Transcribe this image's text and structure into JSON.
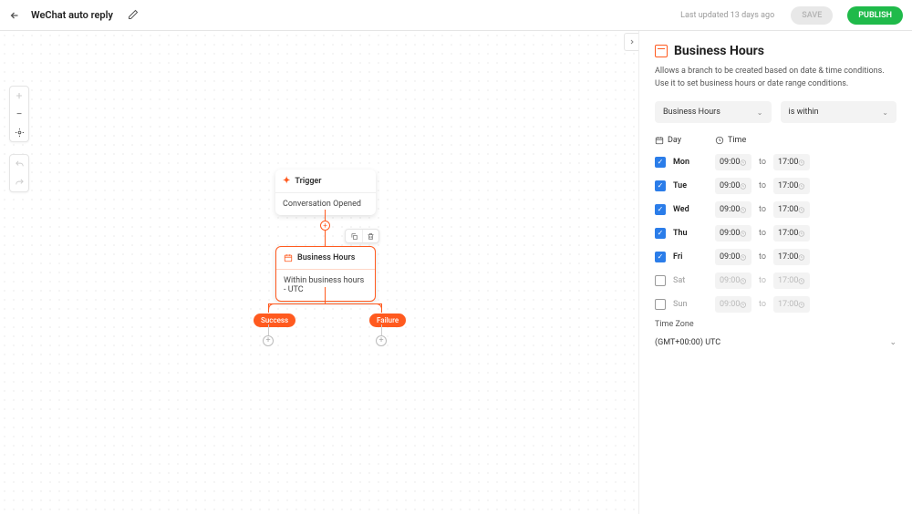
{
  "header": {
    "title": "WeChat auto reply",
    "last_updated": "Last updated 13 days ago",
    "save_label": "SAVE",
    "publish_label": "PUBLISH"
  },
  "canvas": {
    "trigger": {
      "title": "Trigger",
      "body": "Conversation Opened"
    },
    "business_hours": {
      "title": "Business Hours",
      "body": "Within business hours - UTC"
    },
    "branch_success": "Success",
    "branch_failure": "Failure"
  },
  "panel": {
    "title": "Business Hours",
    "description": "Allows a branch to be created based on date & time conditions. Use it to set business hours or date range conditions.",
    "type_select": "Business Hours",
    "condition_select": "is within",
    "day_label": "Day",
    "time_label": "Time",
    "days": [
      {
        "name": "Mon",
        "checked": true,
        "from": "09:00",
        "to": "17:00"
      },
      {
        "name": "Tue",
        "checked": true,
        "from": "09:00",
        "to": "17:00"
      },
      {
        "name": "Wed",
        "checked": true,
        "from": "09:00",
        "to": "17:00"
      },
      {
        "name": "Thu",
        "checked": true,
        "from": "09:00",
        "to": "17:00"
      },
      {
        "name": "Fri",
        "checked": true,
        "from": "09:00",
        "to": "17:00"
      },
      {
        "name": "Sat",
        "checked": false,
        "from": "09:00",
        "to": "17:00"
      },
      {
        "name": "Sun",
        "checked": false,
        "from": "09:00",
        "to": "17:00"
      }
    ],
    "to_label": "to",
    "timezone_label": "Time Zone",
    "timezone": "(GMT+00:00) UTC"
  }
}
